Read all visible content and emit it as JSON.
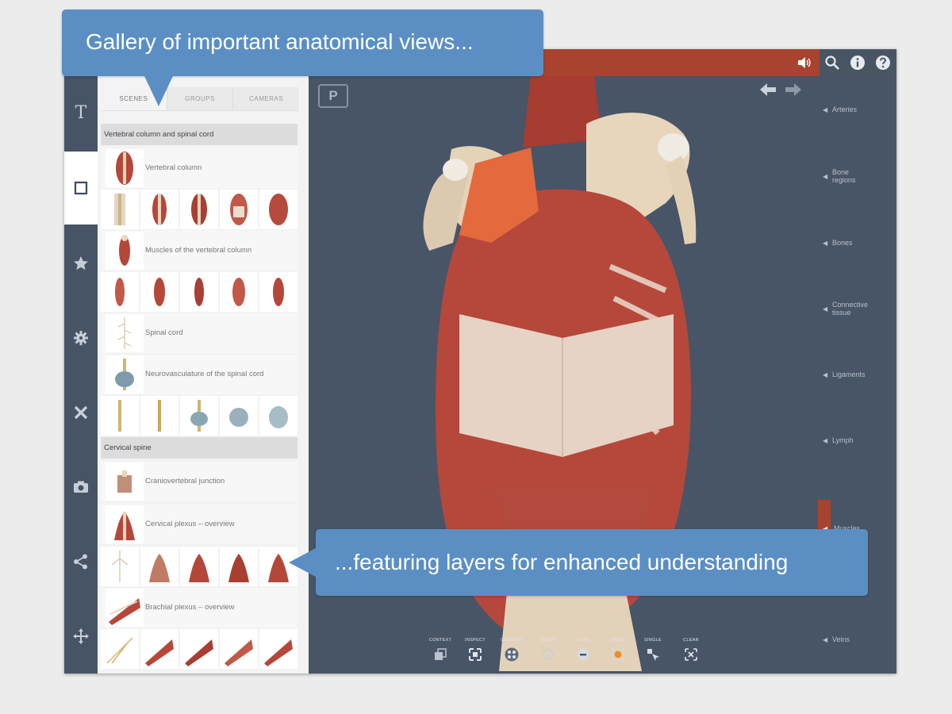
{
  "callouts": {
    "top": "Gallery of important anatomical views...",
    "bottom": "...featuring layers for enhanced understanding"
  },
  "topbar": {
    "icons": [
      "sound-icon",
      "search-icon",
      "info-icon",
      "help-icon"
    ]
  },
  "rail": {
    "items": [
      {
        "name": "text-icon",
        "label": "T"
      },
      {
        "name": "scenes-icon"
      },
      {
        "name": "star-icon"
      },
      {
        "name": "gear-icon"
      },
      {
        "name": "tools-icon"
      },
      {
        "name": "camera-icon"
      },
      {
        "name": "share-icon"
      },
      {
        "name": "move-icon"
      }
    ]
  },
  "panel": {
    "tabs": [
      "SCENES",
      "GROUPS",
      "CAMERAS"
    ],
    "sections": [
      {
        "title": "Vertebral column and spinal cord"
      },
      {
        "title": "Cervical spine"
      }
    ],
    "items": [
      "Vertebral column",
      "Muscles of the vertebral column",
      "Spinal cord",
      "Neurovasculature of the spinal cord",
      "Craniovertebral junction",
      "Cervical plexus – overview",
      "Brachial plexus – overview"
    ]
  },
  "viewport": {
    "logo": "P"
  },
  "rightlist": {
    "items": [
      "Arteries",
      "Bone regions",
      "Bones",
      "Connective tissue",
      "Ligaments",
      "Lymph",
      "Muscles",
      "Veins"
    ],
    "active": "Muscles"
  },
  "toolbar": {
    "tools": [
      "CONTEXT",
      "INSPECT",
      "COMBINE",
      "GHOST",
      "HIDE",
      "ISOMR",
      "SINGLE",
      "CLEAR"
    ]
  },
  "colors": {
    "accent": "#a8432f",
    "callout": "#5b8fc4",
    "background": "#485566"
  }
}
